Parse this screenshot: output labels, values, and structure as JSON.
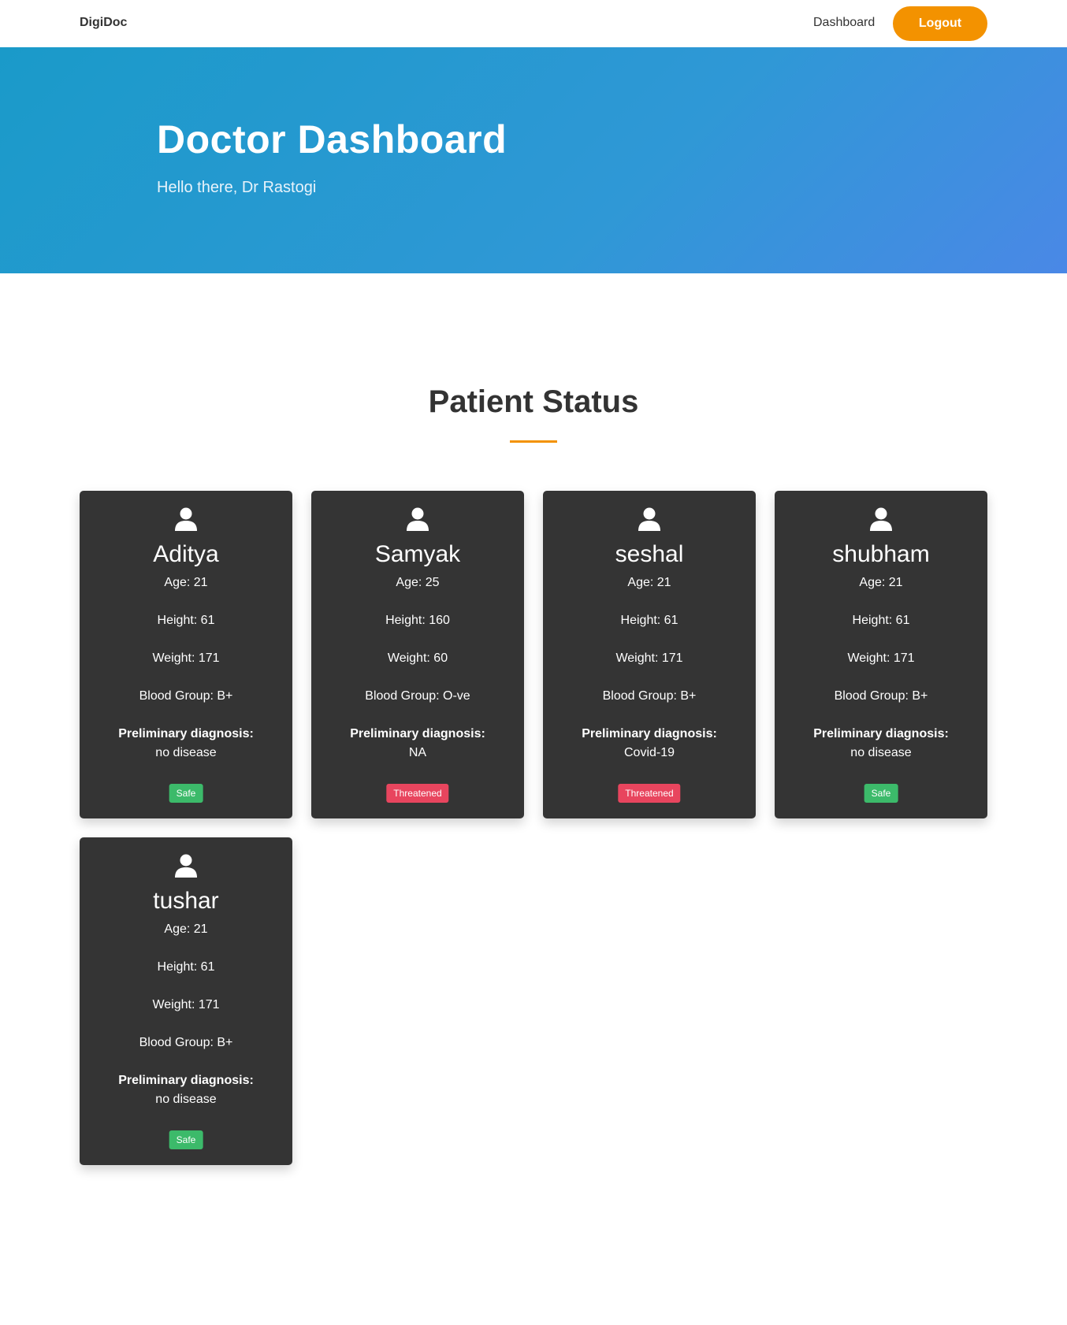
{
  "nav": {
    "brand": "DigiDoc",
    "dashboard_link": "Dashboard",
    "logout_label": "Logout"
  },
  "hero": {
    "title": "Doctor Dashboard",
    "greeting": "Hello there, Dr Rastogi"
  },
  "section": {
    "title": "Patient Status"
  },
  "colors": {
    "accent": "#f39200",
    "card_bg": "#343434",
    "safe": "#3cba6a",
    "threatened": "#e8455e",
    "hero_start": "#1a9ac9",
    "hero_end": "#4a88e6"
  },
  "patients": [
    {
      "name": "Aditya",
      "age": "Age: 21",
      "height": "Height: 61",
      "weight": "Weight: 171",
      "blood": "Blood Group: B+",
      "diag_label": "Preliminary diagnosis:",
      "diagnosis": "no disease",
      "status": "Safe",
      "icon": "user-icon"
    },
    {
      "name": "Samyak",
      "age": "Age: 25",
      "height": "Height: 160",
      "weight": "Weight: 60",
      "blood": "Blood Group: O-ve",
      "diag_label": "Preliminary diagnosis:",
      "diagnosis": "NA",
      "status": "Threatened",
      "icon": "user-icon"
    },
    {
      "name": "seshal",
      "age": "Age: 21",
      "height": "Height: 61",
      "weight": "Weight: 171",
      "blood": "Blood Group: B+",
      "diag_label": "Preliminary diagnosis:",
      "diagnosis": "Covid-19",
      "status": "Threatened",
      "icon": "user-icon"
    },
    {
      "name": "shubham",
      "age": "Age: 21",
      "height": "Height: 61",
      "weight": "Weight: 171",
      "blood": "Blood Group: B+",
      "diag_label": "Preliminary diagnosis:",
      "diagnosis": "no disease",
      "status": "Safe",
      "icon": "user-icon"
    },
    {
      "name": "tushar",
      "age": "Age: 21",
      "height": "Height: 61",
      "weight": "Weight: 171",
      "blood": "Blood Group: B+",
      "diag_label": "Preliminary diagnosis:",
      "diagnosis": "no disease",
      "status": "Safe",
      "icon": "user-icon"
    }
  ]
}
